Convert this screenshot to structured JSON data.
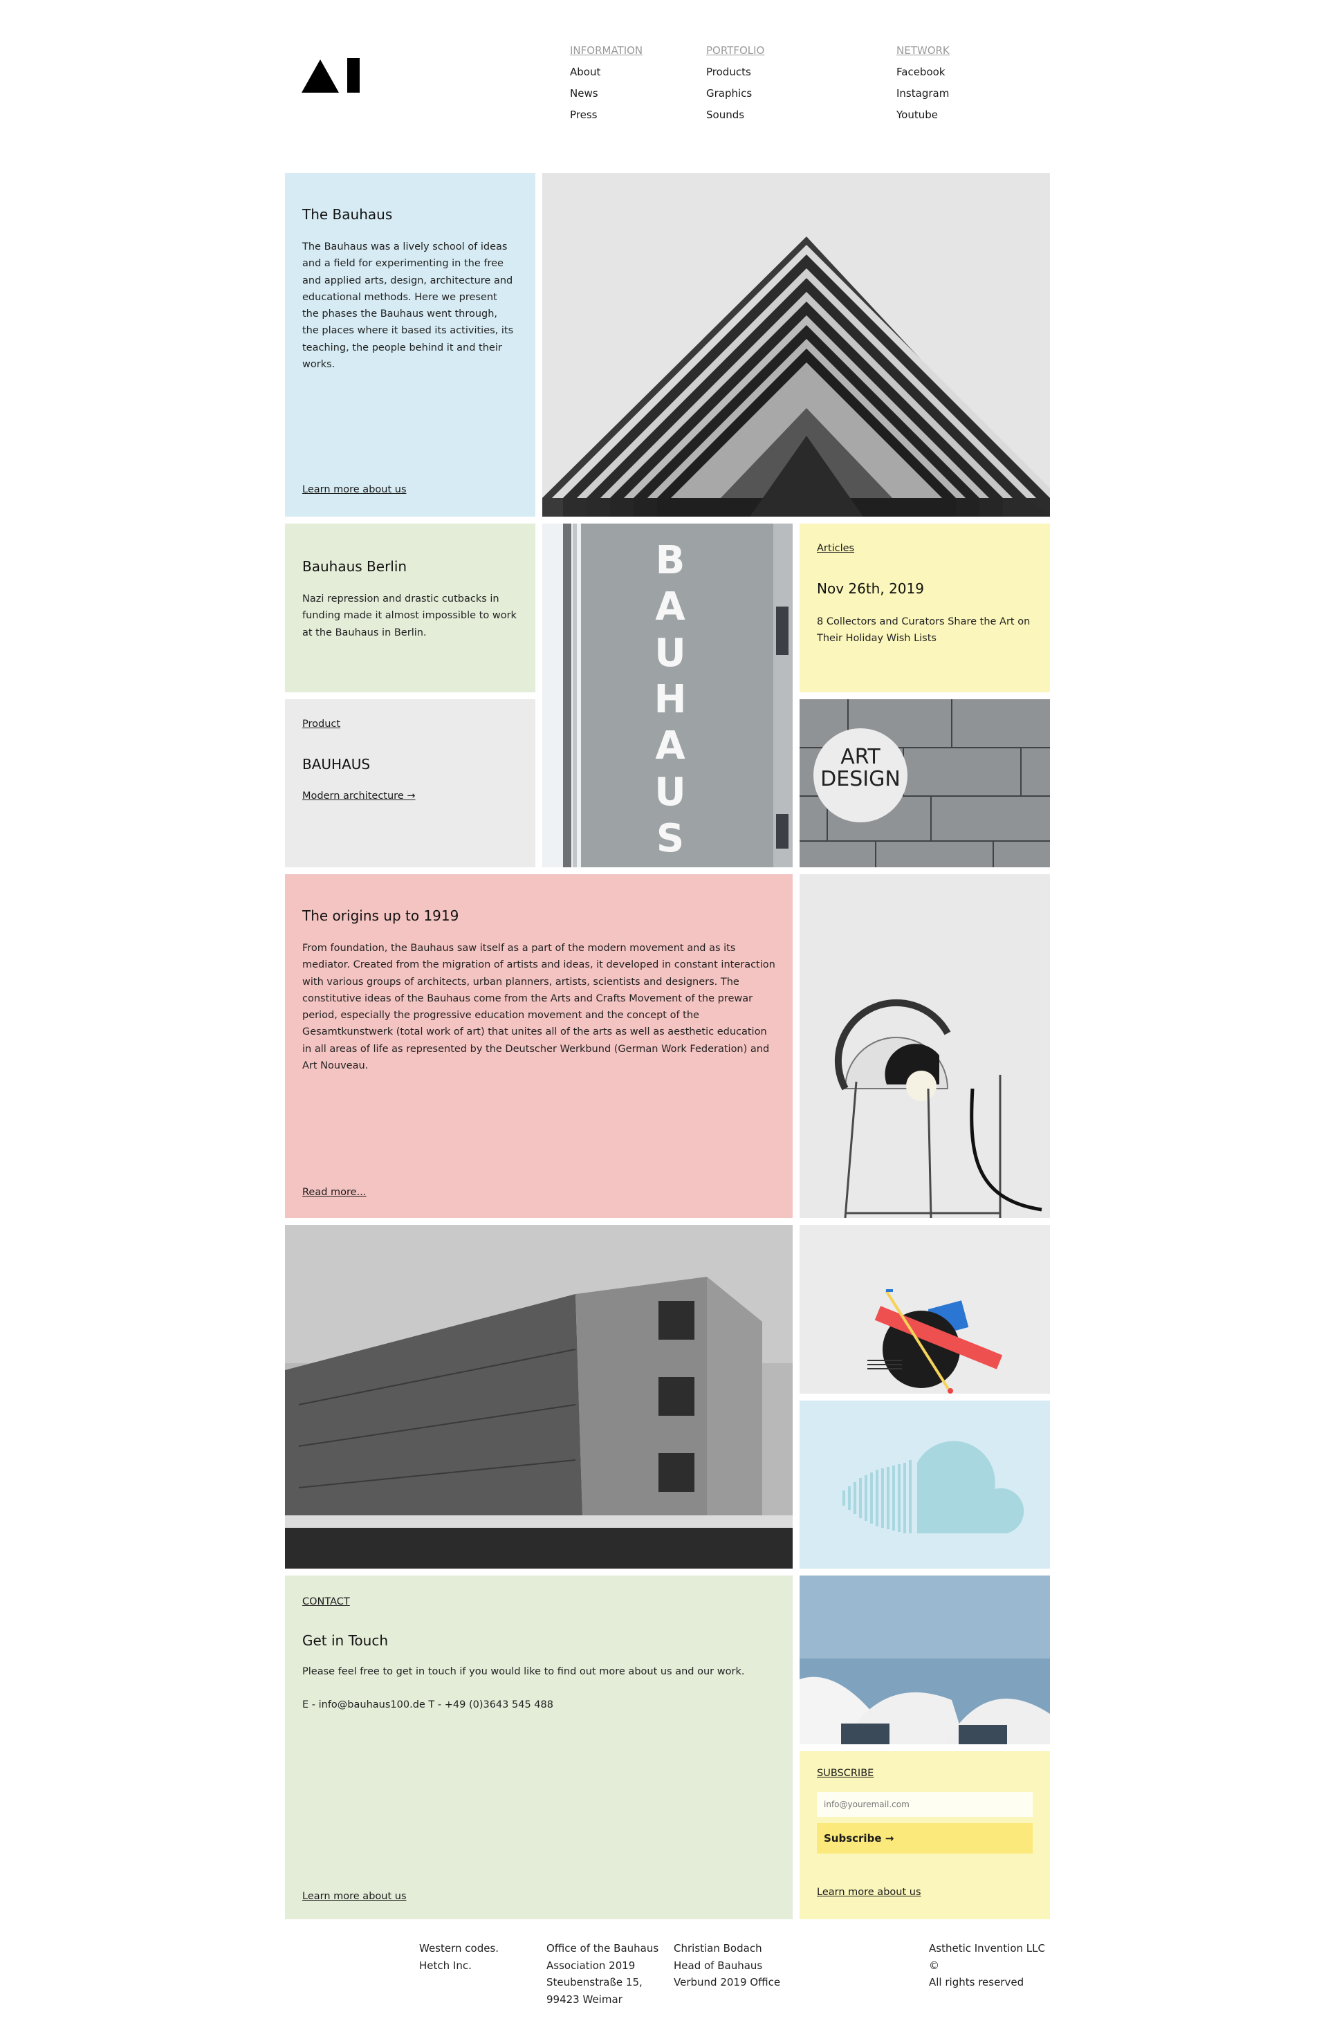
{
  "nav": {
    "columns": [
      {
        "heading": "INFORMATION",
        "links": [
          "About",
          "News",
          "Press"
        ]
      },
      {
        "heading": "PORTFOLIO",
        "links": [
          "Products",
          "Graphics",
          "Sounds"
        ]
      },
      {
        "heading": "NETWORK",
        "links": [
          "Facebook",
          "Instagram",
          "Youtube"
        ]
      }
    ]
  },
  "bauhaus": {
    "title": "The Bauhaus",
    "text": "The Bauhaus was a lively school of ideas and a field for experimenting in the free and applied arts, design, architecture and educational methods. Here we present the phases the Bauhaus went through, the places where it based its activities, its teaching, the people behind it and their works.",
    "link": "Learn more about us"
  },
  "berlin": {
    "title": "Bauhaus Berlin",
    "text": "Nazi repression and drastic cutbacks in funding made it almost impossible to work at the Bauhaus in Berlin."
  },
  "articles": {
    "label": "Articles",
    "date": "Nov 26th, 2019",
    "text": "8 Collectors and Curators Share the Art on Their Holiday Wish Lists"
  },
  "product": {
    "label": "Product",
    "title": "BAUHAUS",
    "link": "Modern architecture →"
  },
  "signs": {
    "vertical_letters": [
      "B",
      "A",
      "U",
      "H",
      "A",
      "U",
      "S"
    ],
    "art_line1": "ART",
    "art_line2": "DESIGN"
  },
  "origins": {
    "title": "The origins up to 1919",
    "text": "From foundation, the Bauhaus saw itself as a part of the modern movement and as its mediator. Created from the migration of artists and ideas, it developed in constant interaction with various groups of architects, urban planners, artists, scientists and designers. The constitutive ideas of the Bauhaus come from the Arts and Crafts Movement of the prewar period, especially the progressive education movement and the concept of the Gesamtkunstwerk (total work of art) that unites all of the arts as well as aesthetic education in all areas of life as represented by the Deutscher Werkbund (German Work Federation) and Art Nouveau.",
    "link": "Read more..."
  },
  "contact": {
    "label": "CONTACT",
    "title": "Get in Touch",
    "text": "Please feel free to get in touch if you would like to find out more about us and our work.",
    "details": "E - info@bauhaus100.de T - +49 (0)3643 545 488",
    "link": "Learn more about us"
  },
  "subscribe": {
    "label": "SUBSCRIBE",
    "placeholder": "info@youremail.com",
    "button": "Subscribe →",
    "link": "Learn more about us"
  },
  "footer": {
    "col1": [
      "Western codes.",
      "Hetch Inc."
    ],
    "col2": [
      "Office of the Bauhaus",
      "Association 2019",
      "Steubenstraße 15,",
      "99423 Weimar"
    ],
    "col3": [
      "Christian Bodach",
      "Head of Bauhaus",
      "Verbund 2019 Office"
    ],
    "col4": [
      "Asthetic Invention LLC",
      "©",
      "All rights reserved"
    ]
  },
  "colors": {
    "blue": "#d6ebf3",
    "green": "#e4edd8",
    "yellow": "#fbf6bb",
    "grey": "#ebebeb",
    "pink": "#f4c4c2",
    "subscribe_button": "#fbe97c"
  }
}
